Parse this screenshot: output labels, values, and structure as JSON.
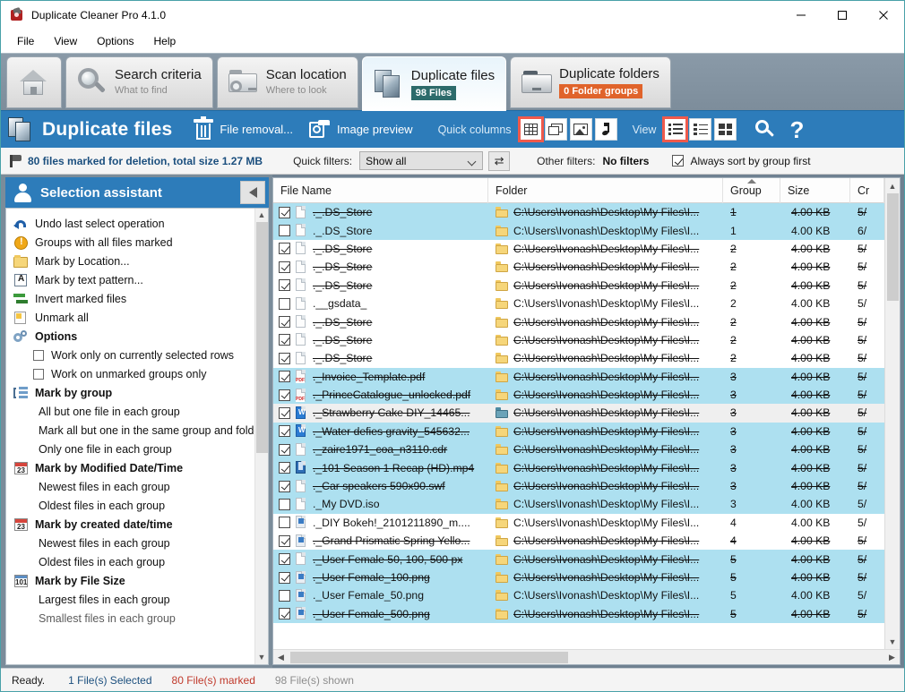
{
  "window": {
    "title": "Duplicate Cleaner Pro 4.1.0",
    "app_icon": "app-icon",
    "minimize": "–",
    "maximize": "□",
    "close": "✕"
  },
  "menubar": {
    "items": [
      {
        "label": "File"
      },
      {
        "label": "View"
      },
      {
        "label": "Options"
      },
      {
        "label": "Help"
      }
    ]
  },
  "tabs": [
    {
      "label": "",
      "sub": "",
      "icon": "home-icon",
      "badge": "",
      "active": false
    },
    {
      "label": "Search criteria",
      "sub": "What to find",
      "icon": "magnifier-icon",
      "badge": "",
      "active": false
    },
    {
      "label": "Scan location",
      "sub": "Where to look",
      "icon": "folder-search-icon",
      "badge": "",
      "active": false
    },
    {
      "label": "Duplicate files",
      "sub": "",
      "icon": "duplicate-files-icon",
      "badge": "98 Files",
      "badge_color": "#2d6b6b",
      "active": true
    },
    {
      "label": "Duplicate folders",
      "sub": "",
      "icon": "duplicate-folders-icon",
      "badge": "0 Folder groups",
      "badge_color": "#e0632a",
      "active": false
    }
  ],
  "toolbar": {
    "title": "Duplicate files",
    "file_removal": "File removal...",
    "image_preview": "Image preview",
    "quick_columns_label": "Quick columns",
    "view_label": "View",
    "accent": "#2d7cba",
    "selected_outline": "#ef5a4c",
    "quick_column_icons": [
      {
        "name": "table-columns-icon",
        "selected": true
      },
      {
        "name": "window-columns-icon",
        "selected": false
      },
      {
        "name": "image-columns-icon",
        "selected": false
      },
      {
        "name": "audio-columns-icon",
        "selected": false
      }
    ],
    "view_icons": [
      {
        "name": "list-view-icon",
        "selected": true
      },
      {
        "name": "detail-view-icon",
        "selected": false
      },
      {
        "name": "thumbnail-view-icon",
        "selected": false
      }
    ],
    "search_icon": "search-icon",
    "help_icon": "?"
  },
  "filterbar": {
    "marked_summary": "80 files marked for deletion, total size 1.27 MB",
    "quick_filters_label": "Quick filters:",
    "quick_filter_value": "Show all",
    "quick_filter_options": [
      "Show all"
    ],
    "refresh_icon": "⇄",
    "other_filters_label": "Other filters:",
    "other_filters_value": "No filters",
    "sort_by_group_label": "Always sort by group first",
    "sort_by_group_checked": true
  },
  "sidebar": {
    "title": "Selection assistant",
    "collapse_icon": "collapse-left-icon",
    "items": [
      {
        "label": "Undo last select operation",
        "icon": "undo-icon",
        "type": "action"
      },
      {
        "label": "Groups with all files marked",
        "icon": "warning-icon",
        "type": "action"
      },
      {
        "label": "Mark by Location...",
        "icon": "folder-icon",
        "type": "action"
      },
      {
        "label": "Mark by text pattern...",
        "icon": "text-pattern-icon",
        "type": "action"
      },
      {
        "label": "Invert marked files",
        "icon": "invert-icon",
        "type": "action"
      },
      {
        "label": "Unmark all",
        "icon": "unmark-icon",
        "type": "action"
      },
      {
        "label": "Options",
        "icon": "options-gear-icon",
        "type": "header"
      },
      {
        "label": "Work only on currently selected rows",
        "type": "checkbox",
        "checked": false
      },
      {
        "label": "Work on unmarked groups only",
        "type": "checkbox",
        "checked": false
      },
      {
        "label": "Mark by group",
        "icon": "group-icon",
        "type": "header"
      },
      {
        "label": "All but one file in each group",
        "type": "sub"
      },
      {
        "label": "Mark all but one in the same group and folder",
        "type": "sub"
      },
      {
        "label": "Only one file in each group",
        "type": "sub"
      },
      {
        "label": "Mark by Modified Date/Time",
        "icon": "calendar-red-icon",
        "type": "header"
      },
      {
        "label": "Newest files in each group",
        "type": "sub"
      },
      {
        "label": "Oldest files in each group",
        "type": "sub"
      },
      {
        "label": "Mark by created date/time",
        "icon": "calendar-red-icon",
        "type": "header"
      },
      {
        "label": "Newest files in each group",
        "type": "sub"
      },
      {
        "label": "Oldest files in each group",
        "type": "sub"
      },
      {
        "label": "Mark by File Size",
        "icon": "filesize-icon",
        "type": "header"
      },
      {
        "label": "Largest files in each group",
        "type": "sub"
      },
      {
        "label": "Smallest files in each group",
        "type": "sub"
      }
    ]
  },
  "table": {
    "columns": [
      {
        "key": "name",
        "label": "File Name",
        "sorted": false
      },
      {
        "key": "folder",
        "label": "Folder",
        "sorted": false
      },
      {
        "key": "group",
        "label": "Group",
        "sorted": true,
        "sort_dir": "asc"
      },
      {
        "key": "size",
        "label": "Size",
        "sorted": false
      },
      {
        "key": "created",
        "label": "Cr",
        "sorted": false
      }
    ],
    "rows": [
      {
        "checked": true,
        "name": "._.DS_Store",
        "icon": "file-generic-icon",
        "folder": "C:\\Users\\Ivonash\\Desktop\\My Files\\I...",
        "folder_icon": "folder-yellow-icon",
        "group": "1",
        "size": "4.00 KB",
        "created": "5/",
        "bg": "blue",
        "strike": true
      },
      {
        "checked": false,
        "name": "._.DS_Store",
        "icon": "file-generic-icon",
        "folder": "C:\\Users\\Ivonash\\Desktop\\My Files\\I...",
        "folder_icon": "folder-yellow-icon",
        "group": "1",
        "size": "4.00 KB",
        "created": "6/",
        "bg": "blue",
        "strike": false
      },
      {
        "checked": true,
        "name": "._.DS_Store",
        "icon": "file-generic-icon",
        "folder": "C:\\Users\\Ivonash\\Desktop\\My Files\\I...",
        "folder_icon": "folder-yellow-icon",
        "group": "2",
        "size": "4.00 KB",
        "created": "5/",
        "bg": "white",
        "strike": true
      },
      {
        "checked": true,
        "name": "._.DS_Store",
        "icon": "file-generic-icon",
        "folder": "C:\\Users\\Ivonash\\Desktop\\My Files\\I...",
        "folder_icon": "folder-yellow-icon",
        "group": "2",
        "size": "4.00 KB",
        "created": "5/",
        "bg": "white",
        "strike": true
      },
      {
        "checked": true,
        "name": "._.DS_Store",
        "icon": "file-generic-icon",
        "folder": "C:\\Users\\Ivonash\\Desktop\\My Files\\I...",
        "folder_icon": "folder-yellow-icon",
        "group": "2",
        "size": "4.00 KB",
        "created": "5/",
        "bg": "white",
        "strike": true
      },
      {
        "checked": false,
        "name": ".__gsdata_",
        "icon": "file-generic-icon",
        "folder": "C:\\Users\\Ivonash\\Desktop\\My Files\\I...",
        "folder_icon": "folder-yellow-icon",
        "group": "2",
        "size": "4.00 KB",
        "created": "5/",
        "bg": "white",
        "strike": false
      },
      {
        "checked": true,
        "name": "._.DS_Store",
        "icon": "file-generic-icon",
        "folder": "C:\\Users\\Ivonash\\Desktop\\My Files\\I...",
        "folder_icon": "folder-yellow-icon",
        "group": "2",
        "size": "4.00 KB",
        "created": "5/",
        "bg": "white",
        "strike": true
      },
      {
        "checked": true,
        "name": "._.DS_Store",
        "icon": "file-generic-icon",
        "folder": "C:\\Users\\Ivonash\\Desktop\\My Files\\I...",
        "folder_icon": "folder-yellow-icon",
        "group": "2",
        "size": "4.00 KB",
        "created": "5/",
        "bg": "white",
        "strike": true
      },
      {
        "checked": true,
        "name": "._.DS_Store",
        "icon": "file-generic-icon",
        "folder": "C:\\Users\\Ivonash\\Desktop\\My Files\\I...",
        "folder_icon": "folder-yellow-icon",
        "group": "2",
        "size": "4.00 KB",
        "created": "5/",
        "bg": "white",
        "strike": true
      },
      {
        "checked": true,
        "name": "._Invoice_Template.pdf",
        "icon": "file-pdf-icon",
        "folder": "C:\\Users\\Ivonash\\Desktop\\My Files\\I...",
        "folder_icon": "folder-yellow-icon",
        "group": "3",
        "size": "4.00 KB",
        "created": "5/",
        "bg": "blue",
        "strike": true
      },
      {
        "checked": true,
        "name": "._PrinceCatalogue_unlocked.pdf",
        "icon": "file-pdf-icon",
        "folder": "C:\\Users\\Ivonash\\Desktop\\My Files\\I...",
        "folder_icon": "folder-yellow-icon",
        "group": "3",
        "size": "4.00 KB",
        "created": "5/",
        "bg": "blue",
        "strike": true
      },
      {
        "checked": true,
        "name": "._Strawberry Cake DIY_14465...",
        "icon": "file-word-icon",
        "folder": "C:\\Users\\Ivonash\\Desktop\\My Files\\I...",
        "folder_icon": "folder-teal-icon",
        "group": "3",
        "size": "4.00 KB",
        "created": "5/",
        "bg": "selrow",
        "strike": true
      },
      {
        "checked": true,
        "name": "._Water defies gravity_545632...",
        "icon": "file-word-icon",
        "folder": "C:\\Users\\Ivonash\\Desktop\\My Files\\I...",
        "folder_icon": "folder-yellow-icon",
        "group": "3",
        "size": "4.00 KB",
        "created": "5/",
        "bg": "blue",
        "strike": true
      },
      {
        "checked": true,
        "name": "._zaire1971_coa_n3110.cdr",
        "icon": "file-generic-icon",
        "folder": "C:\\Users\\Ivonash\\Desktop\\My Files\\I...",
        "folder_icon": "folder-yellow-icon",
        "group": "3",
        "size": "4.00 KB",
        "created": "5/",
        "bg": "blue",
        "strike": true
      },
      {
        "checked": true,
        "name": "._101 Season 1 Recap (HD).mp4",
        "icon": "file-video-icon",
        "folder": "C:\\Users\\Ivonash\\Desktop\\My Files\\I...",
        "folder_icon": "folder-yellow-icon",
        "group": "3",
        "size": "4.00 KB",
        "created": "5/",
        "bg": "blue",
        "strike": true
      },
      {
        "checked": true,
        "name": "._Car speakers 590x90.swf",
        "icon": "file-generic-icon",
        "folder": "C:\\Users\\Ivonash\\Desktop\\My Files\\I...",
        "folder_icon": "folder-yellow-icon",
        "group": "3",
        "size": "4.00 KB",
        "created": "5/",
        "bg": "blue",
        "strike": true
      },
      {
        "checked": false,
        "name": "._My DVD.iso",
        "icon": "file-generic-icon",
        "folder": "C:\\Users\\Ivonash\\Desktop\\My Files\\I...",
        "folder_icon": "folder-yellow-icon",
        "group": "3",
        "size": "4.00 KB",
        "created": "5/",
        "bg": "blue",
        "strike": false
      },
      {
        "checked": false,
        "name": "._DIY Bokeh!_2101211890_m....",
        "icon": "file-image-icon",
        "folder": "C:\\Users\\Ivonash\\Desktop\\My Files\\I...",
        "folder_icon": "folder-yellow-icon",
        "group": "4",
        "size": "4.00 KB",
        "created": "5/",
        "bg": "white",
        "strike": false
      },
      {
        "checked": true,
        "name": "._Grand Prismatic Spring Yello...",
        "icon": "file-image-icon",
        "folder": "C:\\Users\\Ivonash\\Desktop\\My Files\\I...",
        "folder_icon": "folder-yellow-icon",
        "group": "4",
        "size": "4.00 KB",
        "created": "5/",
        "bg": "white",
        "strike": true
      },
      {
        "checked": true,
        "name": "._User Female 50, 100, 500 px",
        "icon": "file-generic-icon",
        "folder": "C:\\Users\\Ivonash\\Desktop\\My Files\\I...",
        "folder_icon": "folder-yellow-icon",
        "group": "5",
        "size": "4.00 KB",
        "created": "5/",
        "bg": "blue",
        "strike": true
      },
      {
        "checked": true,
        "name": "._User Female_100.png",
        "icon": "file-image-icon",
        "folder": "C:\\Users\\Ivonash\\Desktop\\My Files\\I...",
        "folder_icon": "folder-yellow-icon",
        "group": "5",
        "size": "4.00 KB",
        "created": "5/",
        "bg": "blue",
        "strike": true
      },
      {
        "checked": false,
        "name": "._User Female_50.png",
        "icon": "file-image-icon",
        "folder": "C:\\Users\\Ivonash\\Desktop\\My Files\\I...",
        "folder_icon": "folder-yellow-icon",
        "group": "5",
        "size": "4.00 KB",
        "created": "5/",
        "bg": "blue",
        "strike": false
      },
      {
        "checked": true,
        "name": "._User Female_500.png",
        "icon": "file-image-icon",
        "folder": "C:\\Users\\Ivonash\\Desktop\\My Files\\I...",
        "folder_icon": "folder-yellow-icon",
        "group": "5",
        "size": "4.00 KB",
        "created": "5/",
        "bg": "blue",
        "strike": true
      }
    ]
  },
  "statusbar": {
    "ready": "Ready.",
    "selected": "1 File(s) Selected",
    "marked": "80 File(s) marked",
    "shown": "98 File(s) shown"
  }
}
